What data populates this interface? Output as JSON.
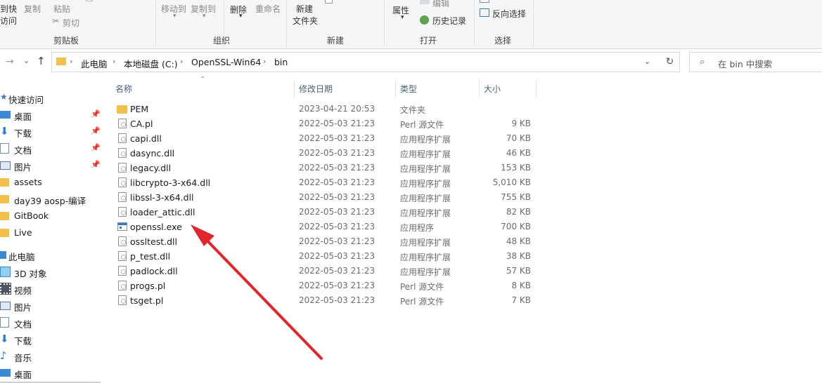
{
  "ribbon": {
    "copy_path_partial": "到快",
    "copy_path_partial_2": "访问",
    "copy": "复制",
    "paste": "粘贴",
    "cut": "剪切",
    "clipboard_group": "剪贴板",
    "move_to": "移动到",
    "copy_to": "复制到",
    "delete": "删除",
    "rename": "重命名",
    "organize_group": "组织",
    "new_folder_1": "新建",
    "new_folder_2": "文件夹",
    "new_group": "新建",
    "properties": "属性",
    "edit": "编辑",
    "history": "历史记录",
    "open_group": "打开",
    "invert_selection": "反向选择",
    "select_group": "选择"
  },
  "address": {
    "crumbs": [
      "此电脑",
      "本地磁盘 (C:)",
      "OpenSSL-Win64",
      "bin"
    ]
  },
  "search": {
    "placeholder": "在 bin 中搜索"
  },
  "nav": {
    "items": [
      {
        "label": "快速访问",
        "icon": "star-icon",
        "pinned": false
      },
      {
        "label": "桌面",
        "icon": "desktop-icon",
        "pinned": true
      },
      {
        "label": "下载",
        "icon": "download-icon",
        "pinned": true
      },
      {
        "label": "文档",
        "icon": "document-icon",
        "pinned": true
      },
      {
        "label": "图片",
        "icon": "picture-icon",
        "pinned": true
      },
      {
        "label": "assets",
        "icon": "folder-icon",
        "pinned": false
      },
      {
        "label": "day39 aosp-编译",
        "icon": "folder-icon",
        "pinned": false
      },
      {
        "label": "GitBook",
        "icon": "folder-icon",
        "pinned": false
      },
      {
        "label": "Live",
        "icon": "folder-icon",
        "pinned": false
      },
      {
        "label": "此电脑",
        "icon": "computer-icon",
        "pinned": false
      },
      {
        "label": "3D 对象",
        "icon": "3d-objects-icon",
        "pinned": false
      },
      {
        "label": "视频",
        "icon": "video-icon",
        "pinned": false
      },
      {
        "label": "图片",
        "icon": "picture-icon",
        "pinned": false
      },
      {
        "label": "文档",
        "icon": "document-icon",
        "pinned": false
      },
      {
        "label": "下载",
        "icon": "download-icon",
        "pinned": false
      },
      {
        "label": "音乐",
        "icon": "music-icon",
        "pinned": false
      },
      {
        "label": "桌面",
        "icon": "desktop-icon",
        "pinned": false
      }
    ]
  },
  "columns": {
    "name": "名称",
    "modified": "修改日期",
    "type": "类型",
    "size": "大小"
  },
  "files": [
    {
      "name": "PEM",
      "date": "2023-04-21 20:53",
      "type": "文件夹",
      "size": "",
      "icon": "folder-icon"
    },
    {
      "name": "CA.pl",
      "date": "2022-05-03 21:23",
      "type": "Perl 源文件",
      "size": "9 KB",
      "icon": "file-icon"
    },
    {
      "name": "capi.dll",
      "date": "2022-05-03 21:23",
      "type": "应用程序扩展",
      "size": "70 KB",
      "icon": "dll-icon"
    },
    {
      "name": "dasync.dll",
      "date": "2022-05-03 21:23",
      "type": "应用程序扩展",
      "size": "46 KB",
      "icon": "dll-icon"
    },
    {
      "name": "legacy.dll",
      "date": "2022-05-03 21:23",
      "type": "应用程序扩展",
      "size": "153 KB",
      "icon": "dll-icon"
    },
    {
      "name": "libcrypto-3-x64.dll",
      "date": "2022-05-03 21:23",
      "type": "应用程序扩展",
      "size": "5,010 KB",
      "icon": "dll-icon"
    },
    {
      "name": "libssl-3-x64.dll",
      "date": "2022-05-03 21:23",
      "type": "应用程序扩展",
      "size": "755 KB",
      "icon": "dll-icon"
    },
    {
      "name": "loader_attic.dll",
      "date": "2022-05-03 21:23",
      "type": "应用程序扩展",
      "size": "82 KB",
      "icon": "dll-icon"
    },
    {
      "name": "openssl.exe",
      "date": "2022-05-03 21:23",
      "type": "应用程序",
      "size": "700 KB",
      "icon": "exe-icon"
    },
    {
      "name": "ossltest.dll",
      "date": "2022-05-03 21:23",
      "type": "应用程序扩展",
      "size": "48 KB",
      "icon": "dll-icon"
    },
    {
      "name": "p_test.dll",
      "date": "2022-05-03 21:23",
      "type": "应用程序扩展",
      "size": "38 KB",
      "icon": "dll-icon"
    },
    {
      "name": "padlock.dll",
      "date": "2022-05-03 21:23",
      "type": "应用程序扩展",
      "size": "57 KB",
      "icon": "dll-icon"
    },
    {
      "name": "progs.pl",
      "date": "2022-05-03 21:23",
      "type": "Perl 源文件",
      "size": "8 KB",
      "icon": "file-icon"
    },
    {
      "name": "tsget.pl",
      "date": "2022-05-03 21:23",
      "type": "Perl 源文件",
      "size": "7 KB",
      "icon": "file-icon"
    }
  ],
  "annotation": {
    "color": "#e0262b",
    "target": "openssl.exe"
  },
  "colors": {
    "folder": "#f2c14b",
    "accent": "#3a78c8",
    "ribbon_bg": "#f5f6f7"
  }
}
